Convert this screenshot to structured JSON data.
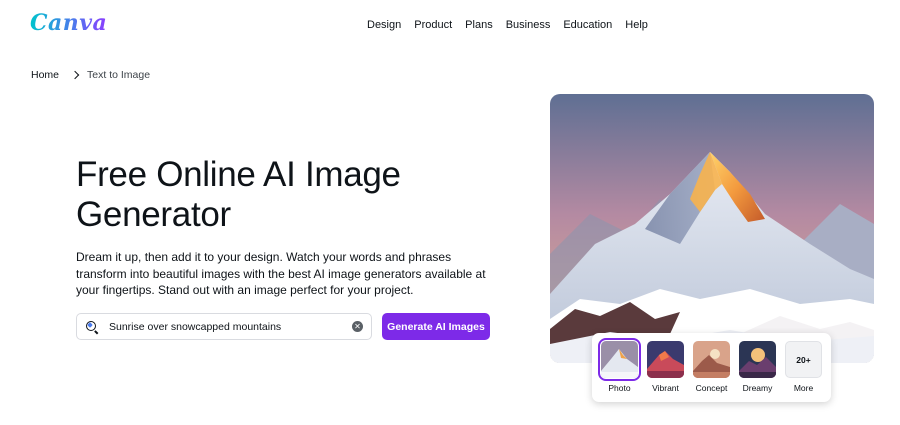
{
  "header": {
    "logo_text": "Canva",
    "nav": [
      "Design",
      "Product",
      "Plans",
      "Business",
      "Education",
      "Help"
    ]
  },
  "breadcrumb": {
    "home": "Home",
    "current": "Text to Image"
  },
  "main": {
    "title": "Free Online AI Image Generator",
    "description": "Dream it up, then add it to your design. Watch your words and phrases transform into beautiful images with the best AI image generators available at your fingertips. Stand out with an image perfect for your project.",
    "search_value": "Sunrise over snowcapped mountains",
    "generate_label": "Generate AI Images"
  },
  "styles": {
    "selected": "Photo",
    "items": [
      {
        "label": "Photo"
      },
      {
        "label": "Vibrant"
      },
      {
        "label": "Concept"
      },
      {
        "label": "Dreamy"
      },
      {
        "label": "More",
        "badge": "20+"
      }
    ]
  },
  "colors": {
    "brand_purple": "#7d2ae8",
    "logo_gradient": [
      "#00c4cc",
      "#4b7bec",
      "#8b3dff"
    ]
  }
}
